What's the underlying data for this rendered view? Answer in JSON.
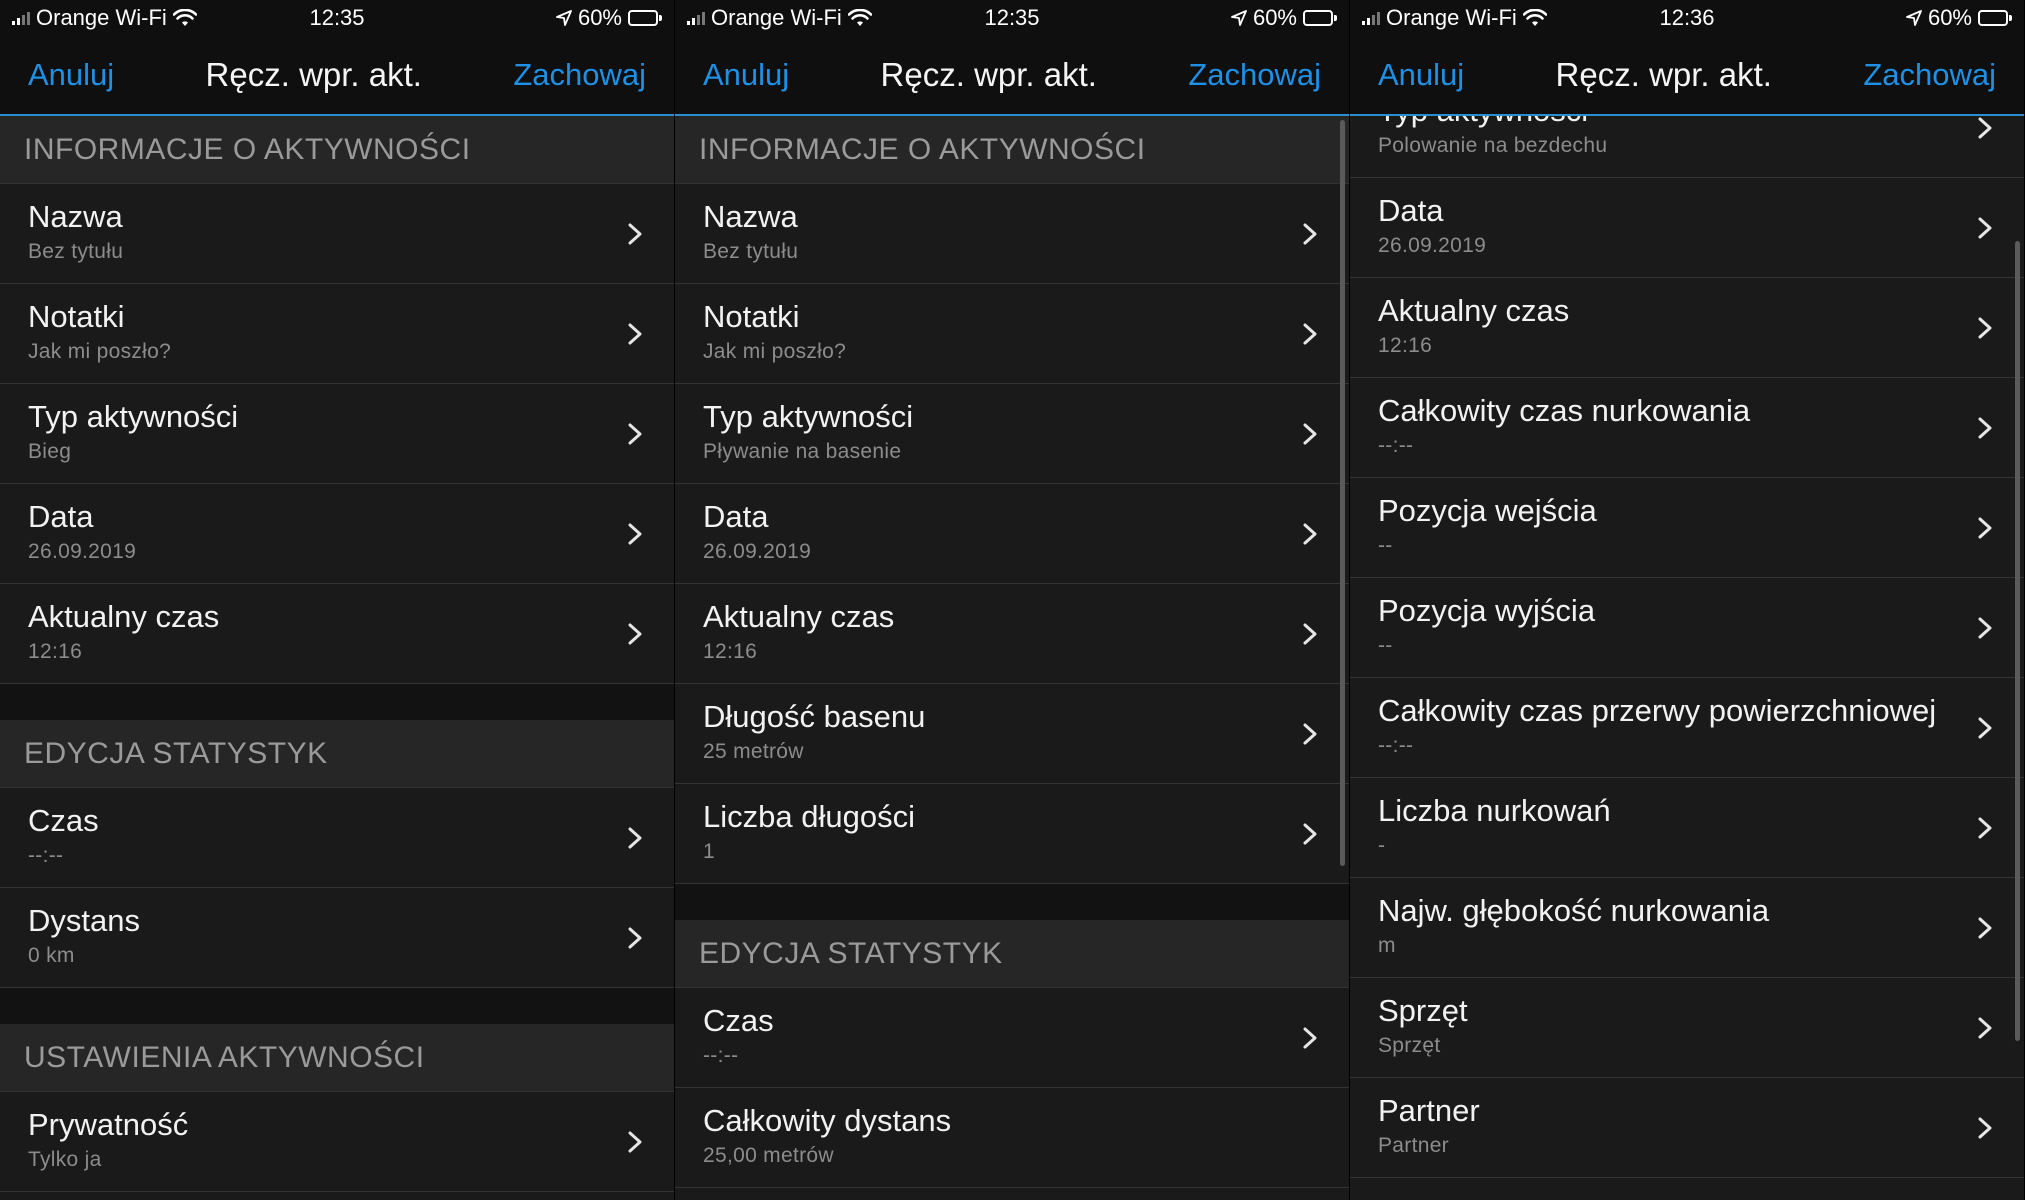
{
  "accent_color": "#1e90e6",
  "screens": [
    {
      "status": {
        "carrier": "Orange Wi-Fi",
        "time": "12:35",
        "battery": "60%"
      },
      "nav": {
        "cancel": "Anuluj",
        "title": "Ręcz. wpr. akt.",
        "save": "Zachowaj"
      },
      "sections": [
        {
          "header": "INFORMACJE O AKTYWNOŚCI",
          "rows": [
            {
              "title": "Nazwa",
              "value": "Bez tytułu"
            },
            {
              "title": "Notatki",
              "value": "Jak mi poszło?"
            },
            {
              "title": "Typ aktywności",
              "value": "Bieg"
            },
            {
              "title": "Data",
              "value": "26.09.2019"
            },
            {
              "title": "Aktualny czas",
              "value": "12:16"
            }
          ]
        },
        {
          "header": "EDYCJA STATYSTYK",
          "rows": [
            {
              "title": "Czas",
              "value": "--:--"
            },
            {
              "title": "Dystans",
              "value": "0 km"
            }
          ]
        },
        {
          "header": "USTAWIENIA AKTYWNOŚCI",
          "rows": [
            {
              "title": "Prywatność",
              "value": "Tylko ja"
            }
          ]
        }
      ]
    },
    {
      "status": {
        "carrier": "Orange Wi-Fi",
        "time": "12:35",
        "battery": "60%"
      },
      "nav": {
        "cancel": "Anuluj",
        "title": "Ręcz. wpr. akt.",
        "save": "Zachowaj"
      },
      "sections": [
        {
          "header": "INFORMACJE O AKTYWNOŚCI",
          "rows": [
            {
              "title": "Nazwa",
              "value": "Bez tytułu"
            },
            {
              "title": "Notatki",
              "value": "Jak mi poszło?"
            },
            {
              "title": "Typ aktywności",
              "value": "Pływanie na basenie"
            },
            {
              "title": "Data",
              "value": "26.09.2019"
            },
            {
              "title": "Aktualny czas",
              "value": "12:16"
            },
            {
              "title": "Długość basenu",
              "value": "25 metrów"
            },
            {
              "title": "Liczba długości",
              "value": "1"
            }
          ]
        },
        {
          "header": "EDYCJA STATYSTYK",
          "rows": [
            {
              "title": "Czas",
              "value": "--:--"
            },
            {
              "title": "Całkowity dystans",
              "value": "25,00 metrów",
              "no_chevron": true
            }
          ]
        }
      ]
    },
    {
      "status": {
        "carrier": "Orange Wi-Fi",
        "time": "12:36",
        "battery": "60%"
      },
      "nav": {
        "cancel": "Anuluj",
        "title": "Ręcz. wpr. akt.",
        "save": "Zachowaj"
      },
      "sections": [
        {
          "header": "",
          "rows": [
            {
              "title": "Typ aktywności",
              "value": "Polowanie na bezdechu"
            },
            {
              "title": "Data",
              "value": "26.09.2019"
            },
            {
              "title": "Aktualny czas",
              "value": "12:16"
            },
            {
              "title": "Całkowity czas nurkowania",
              "value": "--:--"
            },
            {
              "title": "Pozycja wejścia",
              "value": "--"
            },
            {
              "title": "Pozycja wyjścia",
              "value": "--"
            },
            {
              "title": "Całkowity czas przerwy powierzchniowej",
              "value": "--:--"
            },
            {
              "title": "Liczba nurkowań",
              "value": "-"
            },
            {
              "title": "Najw. głębokość nurkowania",
              "value": "m"
            },
            {
              "title": "Sprzęt",
              "value": "Sprzęt"
            },
            {
              "title": "Partner",
              "value": "Partner"
            }
          ]
        }
      ]
    }
  ]
}
